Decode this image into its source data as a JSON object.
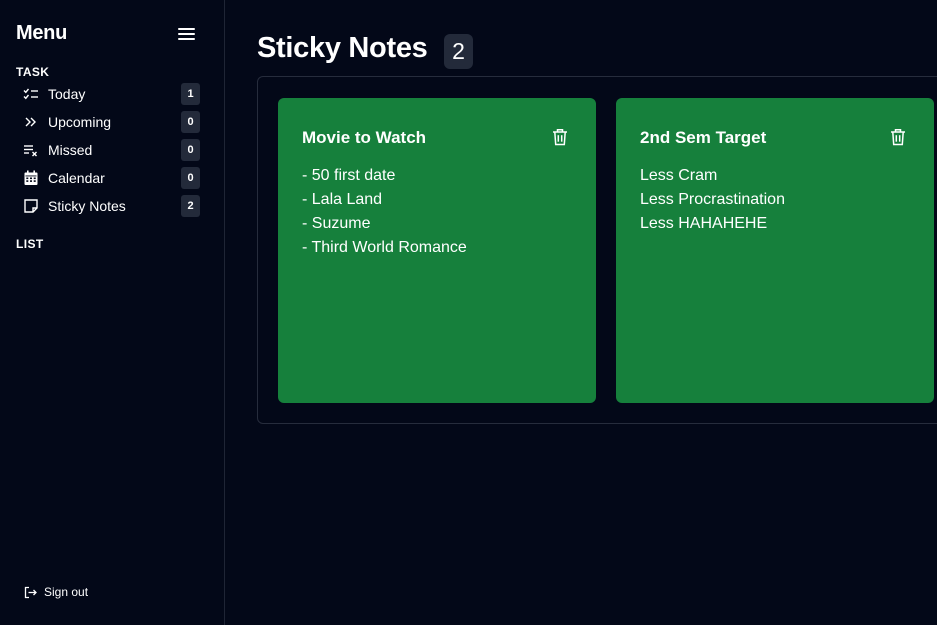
{
  "sidebar": {
    "title": "Menu",
    "task_section": "TASK",
    "list_section": "LIST",
    "items": [
      {
        "label": "Today",
        "count": "1",
        "icon": "checklist-icon"
      },
      {
        "label": "Upcoming",
        "count": "0",
        "icon": "double-chevron-right-icon"
      },
      {
        "label": "Missed",
        "count": "0",
        "icon": "list-x-icon"
      },
      {
        "label": "Calendar",
        "count": "0",
        "icon": "calendar-icon"
      },
      {
        "label": "Sticky Notes",
        "count": "2",
        "icon": "sticky-note-icon"
      }
    ],
    "signout": "Sign out"
  },
  "main": {
    "title": "Sticky Notes",
    "count": "2",
    "notes": [
      {
        "title": "Movie to Watch",
        "lines": [
          "- 50 first date",
          "- Lala Land",
          "- Suzume",
          "- Third World Romance"
        ],
        "color": "#16803c"
      },
      {
        "title": "2nd Sem Target",
        "lines": [
          "Less Cram",
          "Less Procrastination",
          "Less HAHAHEHE"
        ],
        "color": "#16803c"
      }
    ]
  },
  "colors": {
    "background": "#030818",
    "badge": "#232a3a",
    "note": "#16803c"
  }
}
